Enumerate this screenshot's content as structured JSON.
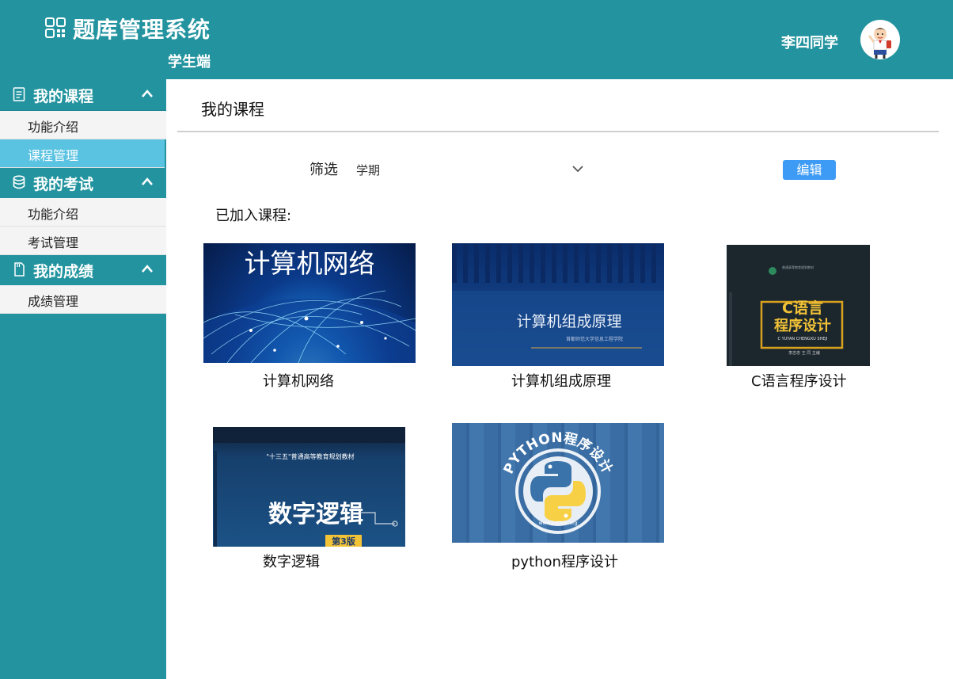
{
  "header": {
    "title": "题库管理系统",
    "subtitle": "学生端",
    "username": "李四同学"
  },
  "sidebar": {
    "groups": [
      {
        "label": "我的课程",
        "items": [
          "功能介绍",
          "课程管理"
        ],
        "active": 1
      },
      {
        "label": "我的考试",
        "items": [
          "功能介绍",
          "考试管理"
        ]
      },
      {
        "label": "我的成绩",
        "items": [
          "成绩管理"
        ]
      }
    ]
  },
  "main": {
    "title": "我的课程",
    "filter": {
      "label": "筛选",
      "value": "学期"
    },
    "edit_label": "编辑",
    "section_label": "已加入课程:",
    "courses": [
      {
        "name": "计算机网络",
        "cover_text": "计算机网络"
      },
      {
        "name": "计算机组成原理",
        "cover_text": "计算机组成原理",
        "cover_sub": "首都师范大学信息工程学院"
      },
      {
        "name": "C语言程序设计",
        "cover_text_1": "C语言",
        "cover_text_2": "程序设计",
        "cover_sub": "C YUYAN CHENGXU SHEJI",
        "cover_top": "普通高等教育规划教材",
        "cover_author": "李志忠  王 同  主编"
      },
      {
        "name": "数字逻辑",
        "cover_text": "数字逻辑",
        "cover_top": "\"十三五\"普通高等教育规划教材",
        "cover_edition": "第3版"
      },
      {
        "name": "python程序设计",
        "cover_text": "PYTHON程序设计",
        "cover_url": "www.python.org"
      }
    ]
  },
  "colors": {
    "primary": "#23949f",
    "active_item": "#5ac3e2",
    "button": "#3d9bf5"
  }
}
